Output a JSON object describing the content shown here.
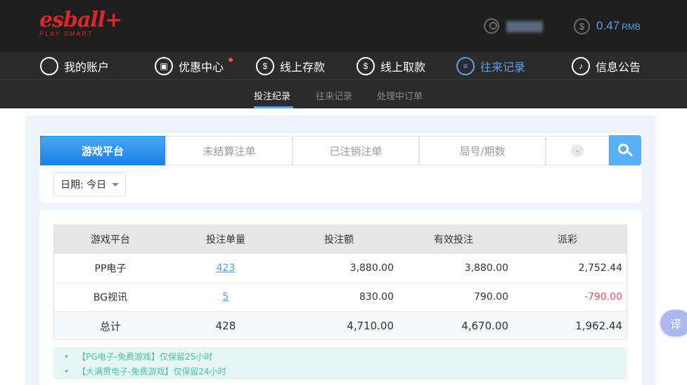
{
  "header": {
    "logo_main": "esball+",
    "logo_sub": "PLAY SMART",
    "balance_amount": "0.47",
    "balance_currency": "RMB"
  },
  "nav": {
    "items": [
      {
        "label": "我的账户",
        "icon": "user-icon"
      },
      {
        "label": "优惠中心",
        "icon": "gift-icon"
      },
      {
        "label": "线上存款",
        "icon": "deposit-icon"
      },
      {
        "label": "线上取款",
        "icon": "withdraw-icon"
      },
      {
        "label": "往来记录",
        "icon": "records-icon",
        "active": true
      },
      {
        "label": "信息公告",
        "icon": "bell-icon"
      }
    ]
  },
  "subnav": {
    "items": [
      "投注纪录",
      "往来记录",
      "处理中订单"
    ],
    "active": "投注纪录"
  },
  "tabs": [
    "游戏平台",
    "未结算注单",
    "已注销注单",
    "局号/期数"
  ],
  "date_filter": "日期: 今日",
  "table": {
    "headers": [
      "游戏平台",
      "投注单量",
      "投注额",
      "有效投注",
      "派彩"
    ],
    "rows": [
      {
        "platform": "PP电子",
        "count": "423",
        "bet": "3,880.00",
        "valid": "3,880.00",
        "payout": "2,752.44"
      },
      {
        "platform": "BG视讯",
        "count": "5",
        "bet": "830.00",
        "valid": "790.00",
        "payout": "-790.00"
      }
    ],
    "total": {
      "label": "总计",
      "count": "428",
      "bet": "4,710.00",
      "valid": "4,670.00",
      "payout": "1,962.44"
    }
  },
  "notes": [
    "【PG电子-免费游戏】仅保留25小时",
    "【大满贯电子-免费游戏】仅保留24小时"
  ],
  "translate_label": "译",
  "colors": {
    "accent": "#1b7fe6",
    "brand": "#d9282a",
    "negative": "#e0505a",
    "note": "#4cc3a8"
  }
}
